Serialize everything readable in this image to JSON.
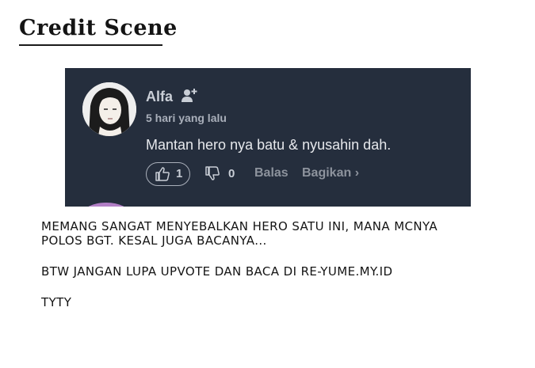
{
  "heading": {
    "title": "Credit Scene"
  },
  "comment_card": {
    "username": "Alfa",
    "timestamp": "5 hari yang lalu",
    "text": "Mantan hero nya batu & nyusahin dah.",
    "like_count": "1",
    "dislike_count": "0",
    "reply_label": "Balas",
    "share_label": "Bagikan ›",
    "icons": {
      "user": "avatar",
      "follow": "add-user-icon",
      "like": "thumbs-up-icon",
      "dislike": "thumbs-down-icon"
    },
    "colors": {
      "background": "#252e3d",
      "text": "#e6e8ec",
      "muted": "#8d939d"
    }
  },
  "notes": {
    "line1": "MEMANG SANGAT MENYEBALKAN HERO SATU INI, MANA MCNYA",
    "line2": "POLOS BGT. KESAL JUGA BACANYA...",
    "line3": "BTW JANGAN LUPA UPVOTE DAN BACA DI RE-YUME.MY.ID",
    "line4": "TYTY"
  }
}
